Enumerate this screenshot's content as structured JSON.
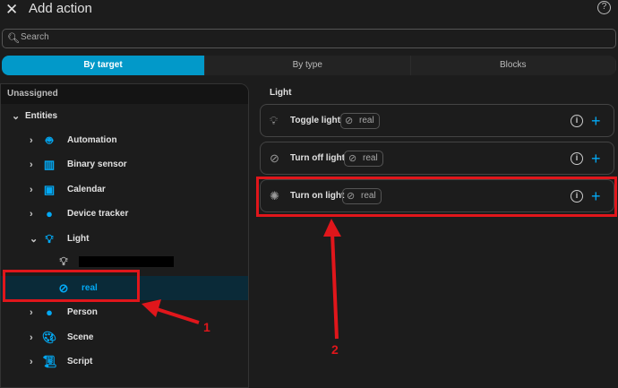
{
  "header": {
    "title": "Add action",
    "close_icon": "close-icon",
    "help_icon": "help-circle-icon"
  },
  "search": {
    "placeholder": "Search",
    "value": ""
  },
  "tabs": [
    {
      "label": "By target",
      "active": true
    },
    {
      "label": "By type",
      "active": false
    },
    {
      "label": "Blocks",
      "active": false
    }
  ],
  "accent_color": "#0299c9",
  "left": {
    "unassigned": "Unassigned",
    "entities": "Entities",
    "items": [
      {
        "label": "Automation",
        "icon": "robot-icon"
      },
      {
        "label": "Binary sensor",
        "icon": "binary-sensor-icon"
      },
      {
        "label": "Calendar",
        "icon": "calendar-icon"
      },
      {
        "label": "Device tracker",
        "icon": "account-icon"
      },
      {
        "label": "Light",
        "icon": "lightbulb-icon",
        "expanded": true
      },
      {
        "label": "real",
        "icon": "lightbulb-off-icon",
        "selected": true
      },
      {
        "label": "Person",
        "icon": "account-icon"
      },
      {
        "label": "Scene",
        "icon": "palette-icon"
      },
      {
        "label": "Script",
        "icon": "script-icon"
      }
    ]
  },
  "right": {
    "title": "Light",
    "actions": [
      {
        "label": "Toggle light",
        "chip": "real",
        "icon": "lightbulb-icon"
      },
      {
        "label": "Turn off light",
        "chip": "real",
        "icon": "lightbulb-off-icon"
      },
      {
        "label": "Turn on light",
        "chip": "real",
        "icon": "lightbulb-on-icon"
      }
    ]
  },
  "annotations": {
    "one": "1",
    "two": "2",
    "color": "#e0161b"
  }
}
